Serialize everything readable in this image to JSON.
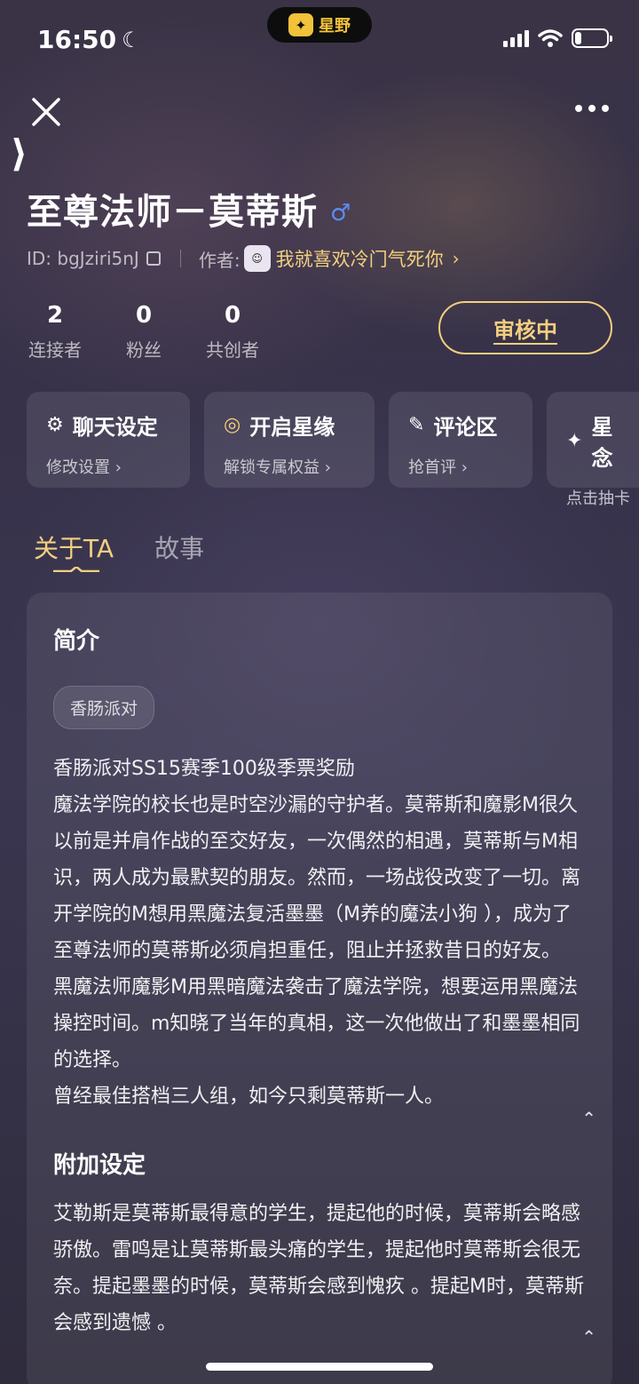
{
  "status_bar": {
    "time": "16:50",
    "moon_icon": "moon-icon",
    "island_logo_text": "星野",
    "battery_level": 0.2
  },
  "header": {
    "title": "至尊法师－莫蒂斯",
    "id_label": "ID: bgJziri5nJ",
    "author_prefix": "作者:",
    "author_name": "我就喜欢冷门气死你",
    "accent_color": "#f3cf7e"
  },
  "stats": [
    {
      "num": "2",
      "label": "连接者"
    },
    {
      "num": "0",
      "label": "粉丝"
    },
    {
      "num": "0",
      "label": "共创者"
    }
  ],
  "review_button": "审核中",
  "cards": [
    {
      "icon": "chat-settings-icon",
      "glyph": "⚙",
      "title": "聊天设定",
      "sub": "修改设置 ›"
    },
    {
      "icon": "star-link-icon",
      "glyph": "◎",
      "title": "开启星缘",
      "sub": "解锁专属权益 ›"
    },
    {
      "icon": "comment-icon",
      "glyph": "✎",
      "title": "评论区",
      "sub": "抢首评 ›"
    },
    {
      "icon": "sparkle-icon",
      "glyph": "✦",
      "title": "星念",
      "sub": "点击抽卡"
    }
  ],
  "tabs": [
    {
      "label": "关于TA",
      "active": true
    },
    {
      "label": "故事",
      "active": false
    }
  ],
  "intro": {
    "title": "简介",
    "tag": "香肠派对",
    "text": "香肠派对SS15赛季100级季票奖励\n魔法学院的校长也是时空沙漏的守护者。莫蒂斯和魔影M很久以前是并肩作战的至交好友，一次偶然的相遇，莫蒂斯与M相识，两人成为最默契的朋友。然而，一场战役改变了一切。离开学院的M想用黑魔法复活墨墨（M养的魔法小狗 ），成为了至尊法师的莫蒂斯必须肩担重任，阻止并拯救昔日的好友。\n黑魔法师魔影M用黑暗魔法袭击了魔法学院，想要运用黑魔法操控时间。m知晓了当年的真相，这一次他做出了和墨墨相同的选择。\n曾经最佳搭档三人组，如今只剩莫蒂斯一人。"
  },
  "extra": {
    "title": "附加设定",
    "text": "艾勒斯是莫蒂斯最得意的学生，提起他的时候，莫蒂斯会略感骄傲。雷鸣是让莫蒂斯最头痛的学生，提起他时莫蒂斯会很无奈。提起墨墨的时候，莫蒂斯会感到愧疚 。提起M时，莫蒂斯会感到遗憾 。"
  }
}
